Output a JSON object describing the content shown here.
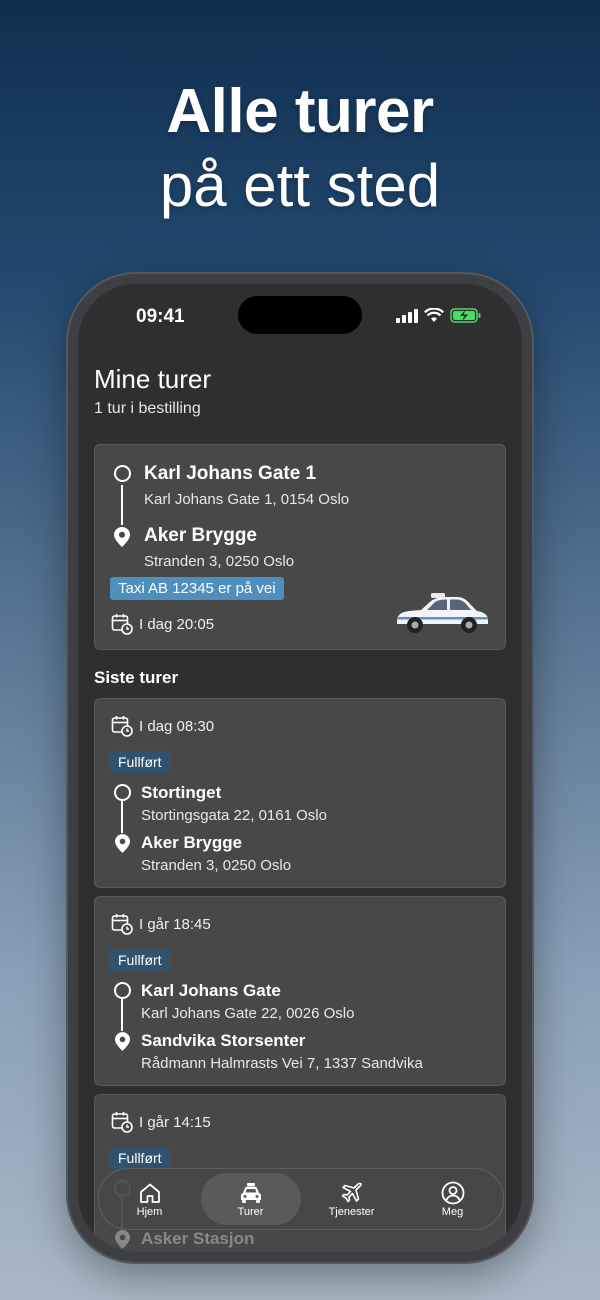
{
  "headline": {
    "line1": "Alle turer",
    "line2": "på ett sted"
  },
  "status_bar": {
    "time": "09:41"
  },
  "page": {
    "title": "Mine turer",
    "subtitle": "1 tur i bestilling"
  },
  "active_trip": {
    "from_name": "Karl Johans Gate 1",
    "from_address": "Karl Johans Gate 1, 0154 Oslo",
    "to_name": "Aker Brygge",
    "to_address": "Stranden 3, 0250 Oslo",
    "status": "Taxi AB 12345 er på vei",
    "datetime": "I dag 20:05"
  },
  "recent_label": "Siste turer",
  "recent_trips": [
    {
      "datetime": "I dag 08:30",
      "status": "Fullført",
      "from_name": "Stortinget",
      "from_address": "Stortingsgata 22, 0161 Oslo",
      "to_name": "Aker Brygge",
      "to_address": "Stranden 3, 0250 Oslo"
    },
    {
      "datetime": "I går 18:45",
      "status": "Fullført",
      "from_name": "Karl Johans Gate",
      "from_address": "Karl Johans Gate 22, 0026 Oslo",
      "to_name": "Sandvika Storsenter",
      "to_address": "Rådmann Halmrasts Vei 7, 1337 Sandvika"
    },
    {
      "datetime": "I går 14:15",
      "status": "Fullført",
      "to_name": "Asker Stasjon"
    }
  ],
  "tabs": [
    {
      "label": "Hjem",
      "icon": "home-icon"
    },
    {
      "label": "Turer",
      "icon": "car-icon"
    },
    {
      "label": "Tjenester",
      "icon": "airplane-icon"
    },
    {
      "label": "Meg",
      "icon": "person-icon"
    }
  ],
  "colors": {
    "accent_blue": "#4e8fbf",
    "completed_badge": "#31526f",
    "card": "#484848",
    "screen": "#2f2f2f"
  }
}
